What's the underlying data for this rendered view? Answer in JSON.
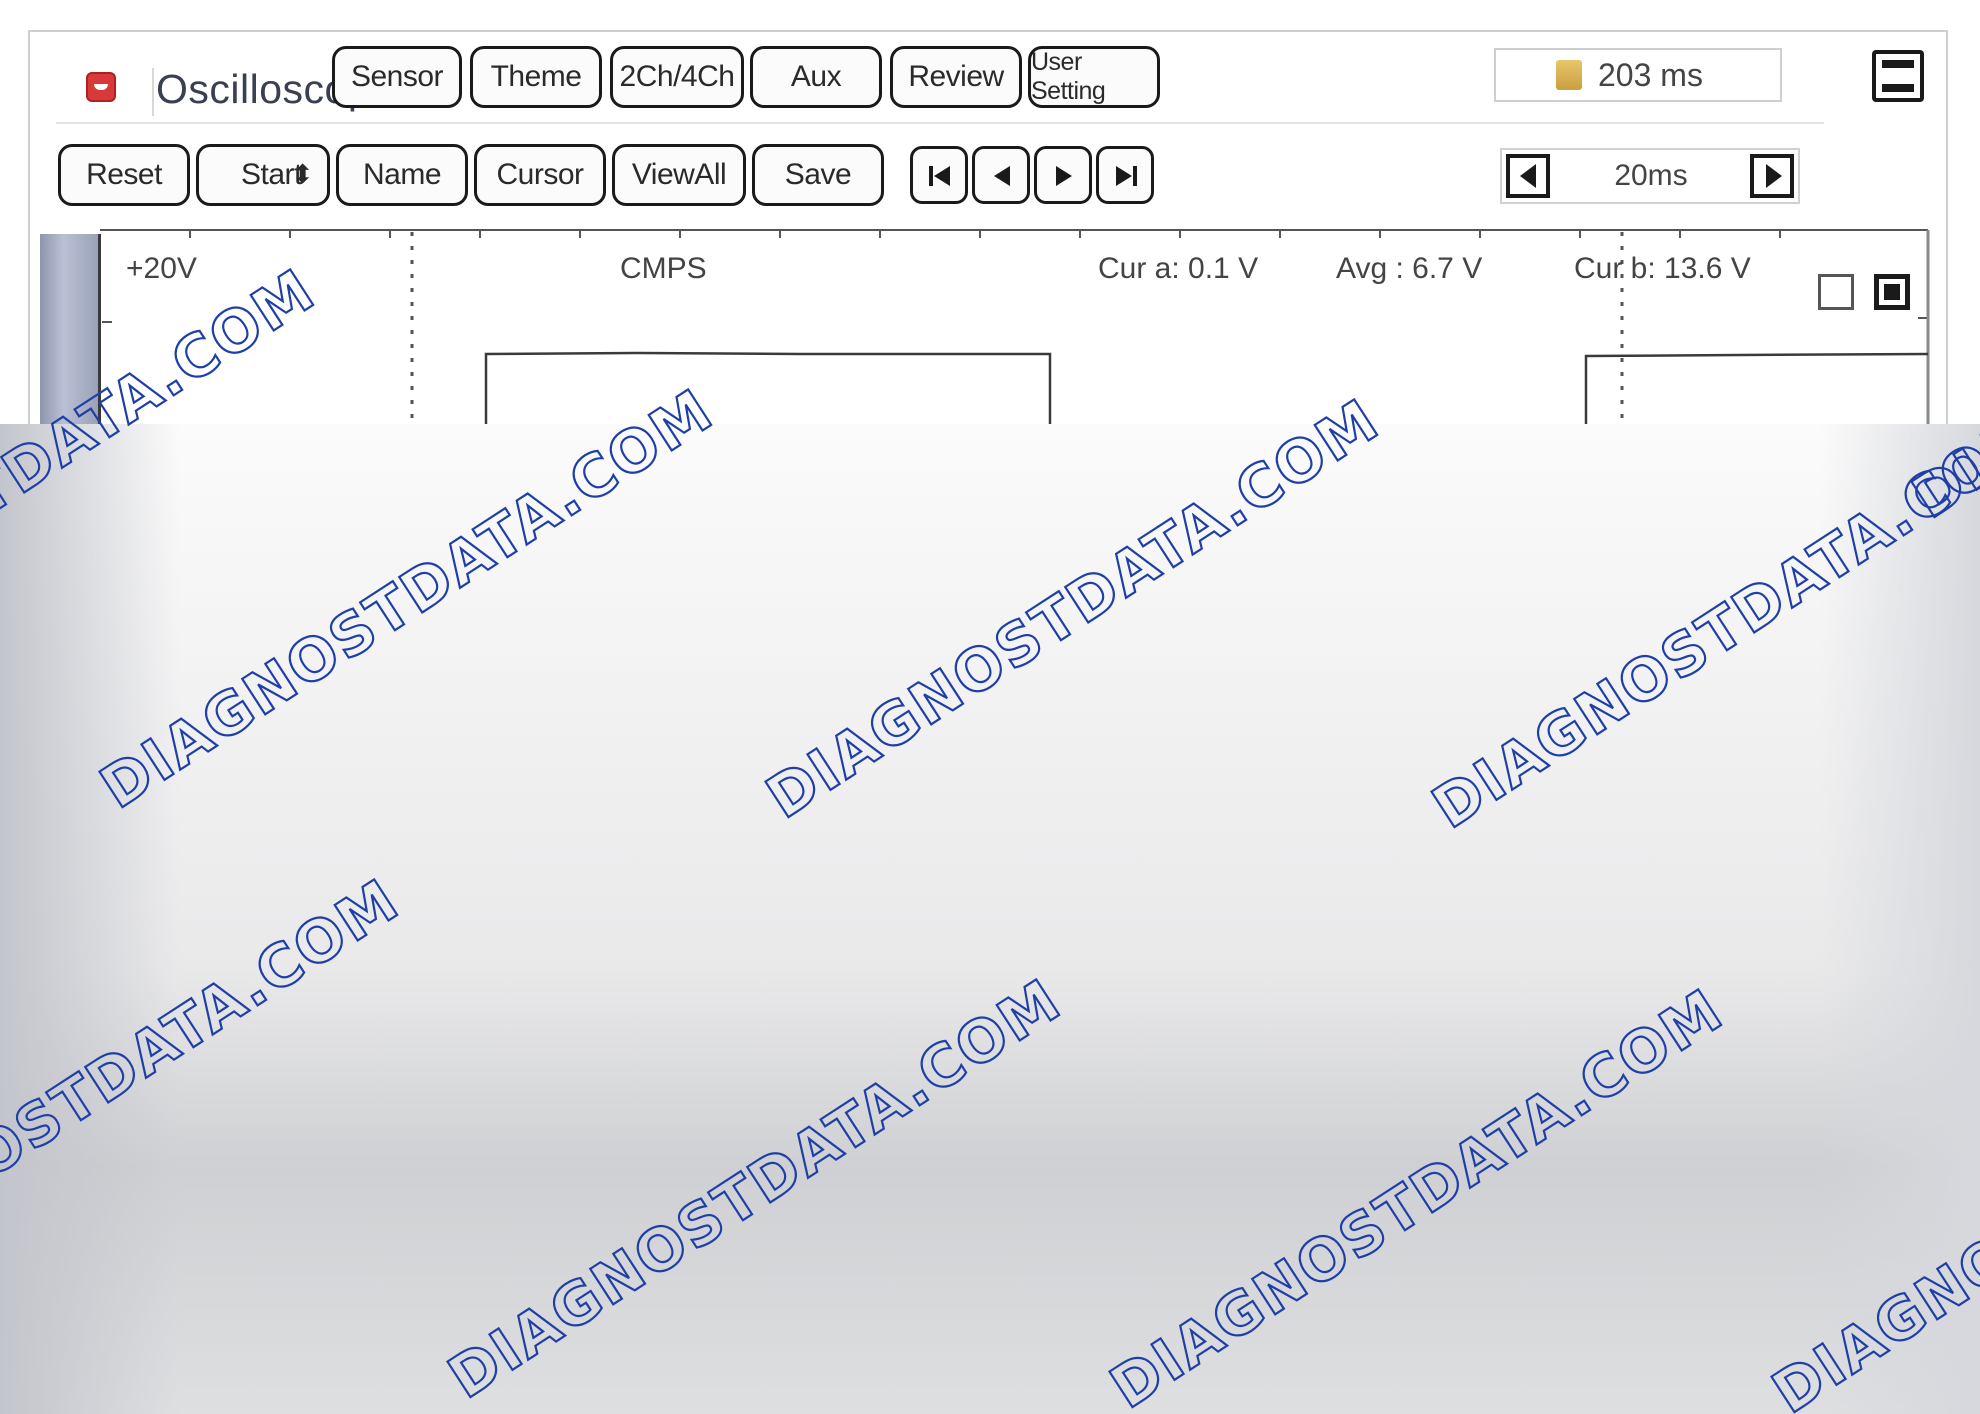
{
  "app": {
    "title": "Oscilloscope",
    "menu_buttons": [
      "Sensor",
      "Theme",
      "2Ch/4Ch",
      "Aux",
      "Review",
      "User Setting"
    ],
    "timer_value": "203 ms"
  },
  "toolbar": {
    "buttons": [
      "Reset",
      "Start",
      "Name",
      "Cursor",
      "ViewAll",
      "Save"
    ],
    "start_spinner": "⬍",
    "nav": [
      "skip-first",
      "previous",
      "next",
      "skip-last"
    ],
    "timebase": "20ms"
  },
  "plot": {
    "y_top_label": "+20V",
    "channel_name": "CMPS",
    "cursor_a": "Cur a: 0.1 V",
    "average": "Avg : 6.7 V",
    "cursor_b": "Cur b: 13.6 V"
  },
  "watermark": "DIAGNOSTDATA.COM",
  "colors": {
    "accent_red": "#d83a3a",
    "trace": "#3a3a3a",
    "watermark_stroke": "#1f3fa8"
  }
}
